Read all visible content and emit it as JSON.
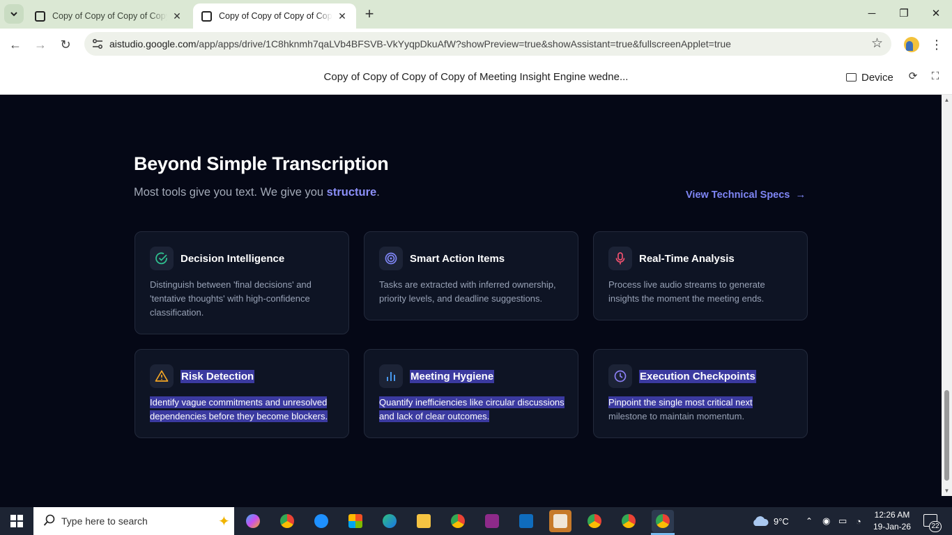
{
  "browser": {
    "tabs": [
      {
        "title": "Copy of Copy of Copy of Copy of Meeting Insight Engine wednesday",
        "active": false
      },
      {
        "title": "Copy of Copy of Copy of Copy of Meeting Insight Engine wednesday",
        "active": true
      }
    ],
    "url_host": "aistudio.google.com",
    "url_path": "/app/apps/drive/1C8hknmh7qaLVb4BFSVB-VkYyqpDkuAfW?showPreview=true&showAssistant=true&fullscreenApplet=true"
  },
  "app_bar": {
    "title": "Copy of Copy of Copy of Copy of Meeting Insight Engine wedne...",
    "device_label": "Device"
  },
  "section": {
    "heading": "Beyond Simple Transcription",
    "subheading_pre": "Most tools give you text. We give you ",
    "subheading_accent": "structure",
    "subheading_post": ".",
    "spec_link": "View Technical Specs",
    "accent_color": "#8b8ff7"
  },
  "cards": [
    {
      "title": "Decision Intelligence",
      "icon": "check-circle-icon",
      "icon_color": "#2fbf8f",
      "desc": "Distinguish between 'final decisions' and 'tentative thoughts' with high-confidence classification.",
      "highlighted": false
    },
    {
      "title": "Smart Action Items",
      "icon": "target-icon",
      "icon_color": "#7f86f5",
      "desc": "Tasks are extracted with inferred ownership, priority levels, and deadline suggestions.",
      "highlighted": false
    },
    {
      "title": "Real-Time Analysis",
      "icon": "microphone-icon",
      "icon_color": "#f0506e",
      "desc": "Process live audio streams to generate insights the moment the meeting ends.",
      "highlighted": false
    },
    {
      "title": "Risk Detection",
      "icon": "warning-triangle-icon",
      "icon_color": "#f5a623",
      "desc": "Identify vague commitments and unresolved dependencies before they become blockers.",
      "highlighted": true
    },
    {
      "title": "Meeting Hygiene",
      "icon": "bar-chart-icon",
      "icon_color": "#4a9ef5",
      "desc": "Quantify inefficiencies like circular discussions and lack of clear outcomes.",
      "highlighted": true
    },
    {
      "title": "Execution Checkpoints",
      "icon": "clock-icon",
      "icon_color": "#8b7ff5",
      "desc_highlighted": "Pinpoint the single most critical next",
      "desc_rest": "milestone to maintain momentum.",
      "highlighted": true
    }
  ],
  "taskbar": {
    "search_placeholder": "Type here to search",
    "weather": "9°C",
    "time": "12:26 AM",
    "date": "19-Jan-26",
    "notifications": "22"
  }
}
